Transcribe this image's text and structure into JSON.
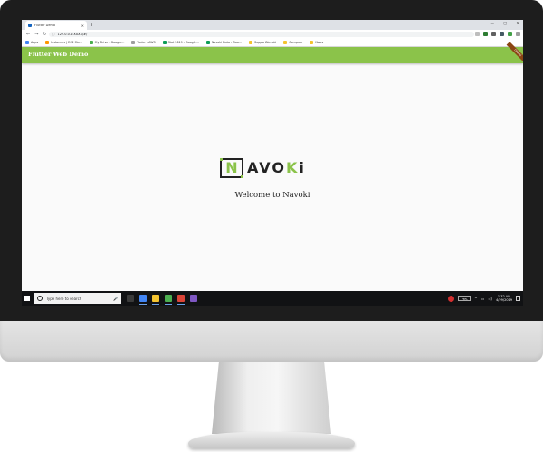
{
  "browser": {
    "tab_title": "Flutter Demo",
    "url": "127.0.0.1:XXXX/#/",
    "bookmarks": [
      {
        "label": "Apps",
        "color": "#4285f4"
      },
      {
        "label": "Instances | EC2 Ma...",
        "color": "#ff9800"
      },
      {
        "label": "My Drive - Google...",
        "color": "#4caf50"
      },
      {
        "label": "Vader - AWS",
        "color": "#9e9e9e"
      },
      {
        "label": "Stat 2019 - Google...",
        "color": "#0f9d58"
      },
      {
        "label": "Navoki Data - Goo...",
        "color": "#0f9d58"
      },
      {
        "label": "SupportNavoki",
        "color": "#f4c430"
      },
      {
        "label": "Compute",
        "color": "#f4c430"
      },
      {
        "label": "News",
        "color": "#f4c430"
      }
    ]
  },
  "app": {
    "title": "Flutter Web Demo",
    "debug_label": "DEBUG",
    "welcome_text": "Welcome to Navoki",
    "accent_color": "#8bc34a"
  },
  "logo": {
    "first_letter": "N",
    "rest_a": "AVO",
    "rest_b": "K",
    "rest_c": "i"
  },
  "taskbar": {
    "search_placeholder": "Type here to search",
    "battery_label": "78%",
    "time": "1:32 AM",
    "date": "4/29/2019",
    "apps": [
      {
        "name": "task-view",
        "color": "#3a3a3a"
      },
      {
        "name": "chrome",
        "color": "#4285f4"
      },
      {
        "name": "file-explorer",
        "color": "#f4c430"
      },
      {
        "name": "app-green",
        "color": "#4caf50"
      },
      {
        "name": "app-chrome-2",
        "color": "#db4437"
      },
      {
        "name": "app-purple",
        "color": "#7e57c2"
      }
    ]
  }
}
